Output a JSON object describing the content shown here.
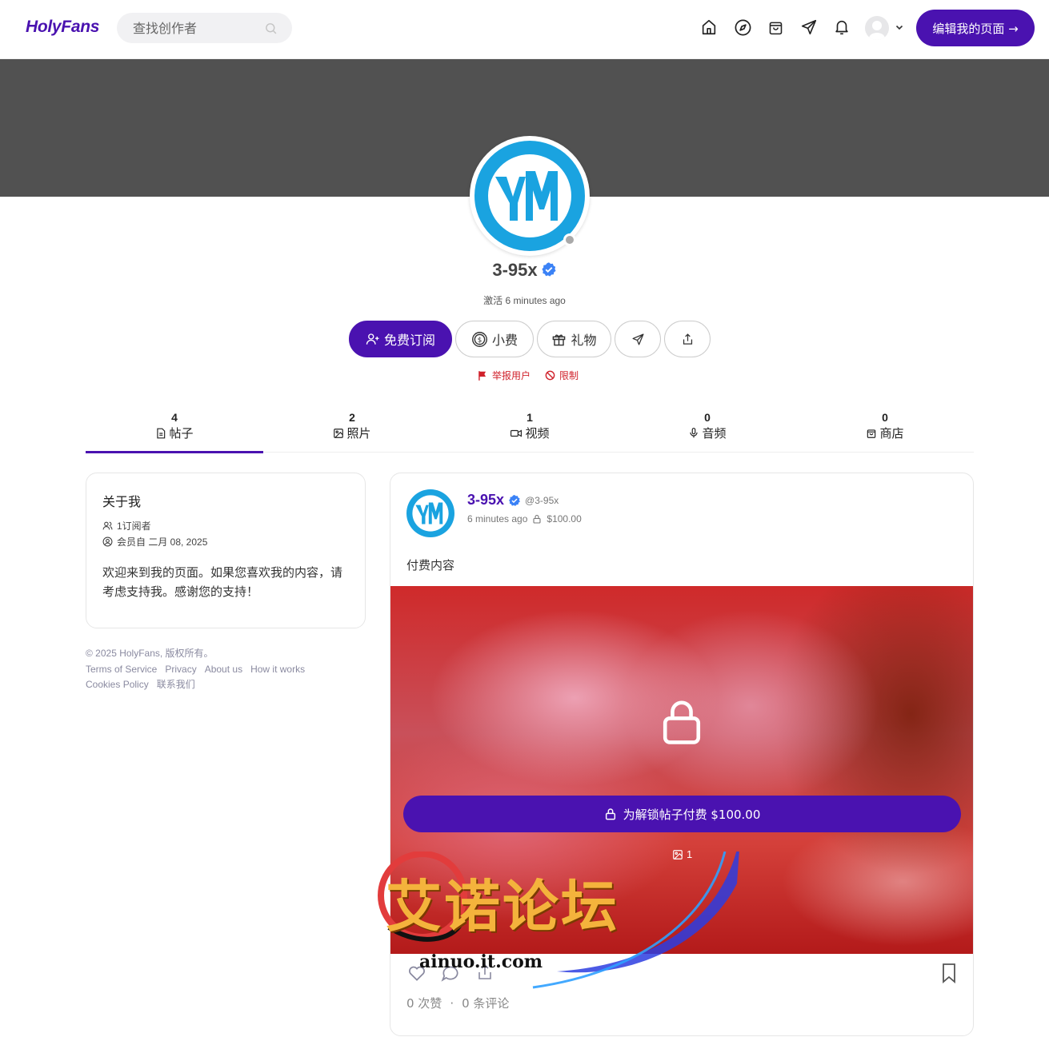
{
  "nav": {
    "logo": "HolyFans",
    "search_placeholder": "查找创作者",
    "icons": [
      "home-icon",
      "compass-icon",
      "shopping-bag-icon",
      "send-icon",
      "bell-icon"
    ],
    "edit_button": "编辑我的页面 →"
  },
  "profile": {
    "name": "3-95x",
    "active": "激活 6 minutes ago",
    "buttons": {
      "subscribe": "免费订阅",
      "tip": "小费",
      "gift": "礼物"
    },
    "report": "举报用户",
    "restrict": "限制"
  },
  "tabs": [
    {
      "count": "4",
      "label": "帖子"
    },
    {
      "count": "2",
      "label": "照片"
    },
    {
      "count": "1",
      "label": "视频"
    },
    {
      "count": "0",
      "label": "音频"
    },
    {
      "count": "0",
      "label": "商店"
    }
  ],
  "about": {
    "title": "关于我",
    "subscribers": "1订阅者",
    "member_since": "会员自 二月 08, 2025",
    "bio": "欢迎来到我的页面。如果您喜欢我的内容，请考虑支持我。感谢您的支持！"
  },
  "footer": {
    "copyright": "© 2025 HolyFans, 版权所有。",
    "links": [
      "Terms of Service",
      "Privacy",
      "About us",
      "How it works",
      "Cookies Policy",
      "联系我们"
    ]
  },
  "post": {
    "author": "3-95x",
    "handle": "@3-95x",
    "time": "6 minutes ago",
    "price": "$100.00",
    "text": "付费内容",
    "unlock_button": "为解锁帖子付费 $100.00",
    "image_count": "1",
    "likes": "0 次赞",
    "comments": "0 条评论"
  },
  "watermark": {
    "text": "艾诺论坛",
    "url": "ainuo.it.com"
  },
  "colors": {
    "brand": "#4a12b0",
    "cover": "#515151",
    "avatar_blue": "#1aa3e0",
    "danger": "#d0212b",
    "verified": "#3b82f6"
  }
}
